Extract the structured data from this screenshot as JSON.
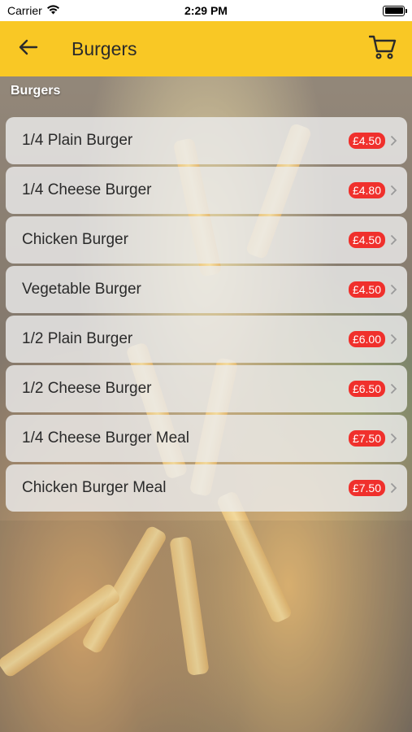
{
  "status_bar": {
    "carrier": "Carrier",
    "time": "2:29 PM"
  },
  "header": {
    "title": "Burgers"
  },
  "section": {
    "label": "Burgers"
  },
  "colors": {
    "header": "#f9c825",
    "price_badge": "#f0302c"
  },
  "icons": {
    "back": "arrow-left-icon",
    "cart": "shopping-cart-icon",
    "row": "chevron-right-icon"
  },
  "items": [
    {
      "name": "1/4 Plain Burger",
      "price": "£4.50"
    },
    {
      "name": "1/4 Cheese Burger",
      "price": "£4.80"
    },
    {
      "name": "Chicken Burger",
      "price": "£4.50"
    },
    {
      "name": "Vegetable Burger",
      "price": "£4.50"
    },
    {
      "name": "1/2 Plain Burger",
      "price": "£6.00"
    },
    {
      "name": "1/2 Cheese Burger",
      "price": "£6.50"
    },
    {
      "name": "1/4 Cheese Burger Meal",
      "price": "£7.50"
    },
    {
      "name": "Chicken Burger Meal",
      "price": "£7.50"
    }
  ]
}
